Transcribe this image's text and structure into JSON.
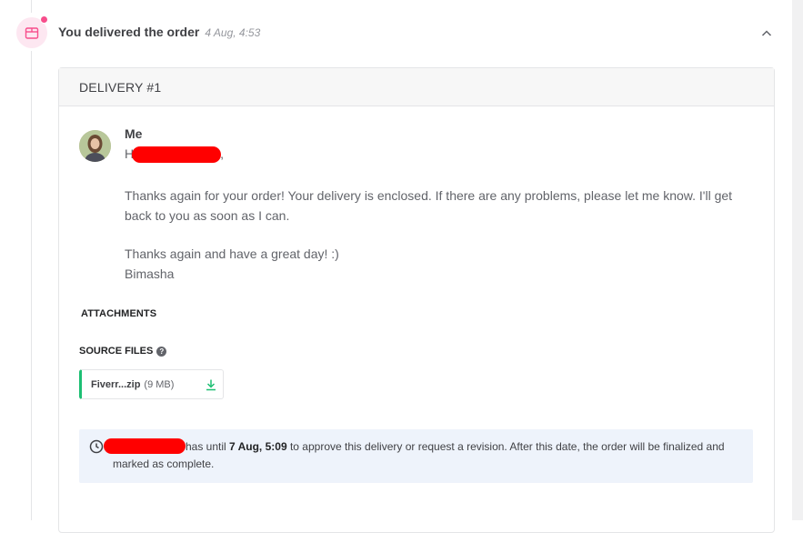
{
  "event": {
    "title": "You delivered the order",
    "time": "4 Aug, 4:53",
    "icon": "package-icon",
    "collapse_icon": "chevron-up-icon"
  },
  "delivery": {
    "header": "DELIVERY #1",
    "sender": "Me",
    "greeting_start": "H",
    "greeting_end": ",",
    "message_line1": "Thanks again for your order! Your delivery is enclosed. If there are any problems, please let me know. I'll get back to you as soon as I can.",
    "message_line2": "Thanks again and have a great day! :)",
    "signature": "Bimasha"
  },
  "attachments": {
    "title": "ATTACHMENTS",
    "source_files_title": "SOURCE FILES",
    "files": [
      {
        "name": "Fiverr...zip",
        "size": "(9 MB)"
      }
    ]
  },
  "notice": {
    "text_before_date": "has until",
    "date": "7 Aug, 5:09",
    "text_after_date": "to approve this delivery or request a revision. After this date, the order will be finalized and marked as complete."
  },
  "colors": {
    "accent_green": "#1dbf73",
    "notice_bg": "#eef3fb",
    "icon_pink": "#f74e8c",
    "redaction": "#ff0000"
  }
}
